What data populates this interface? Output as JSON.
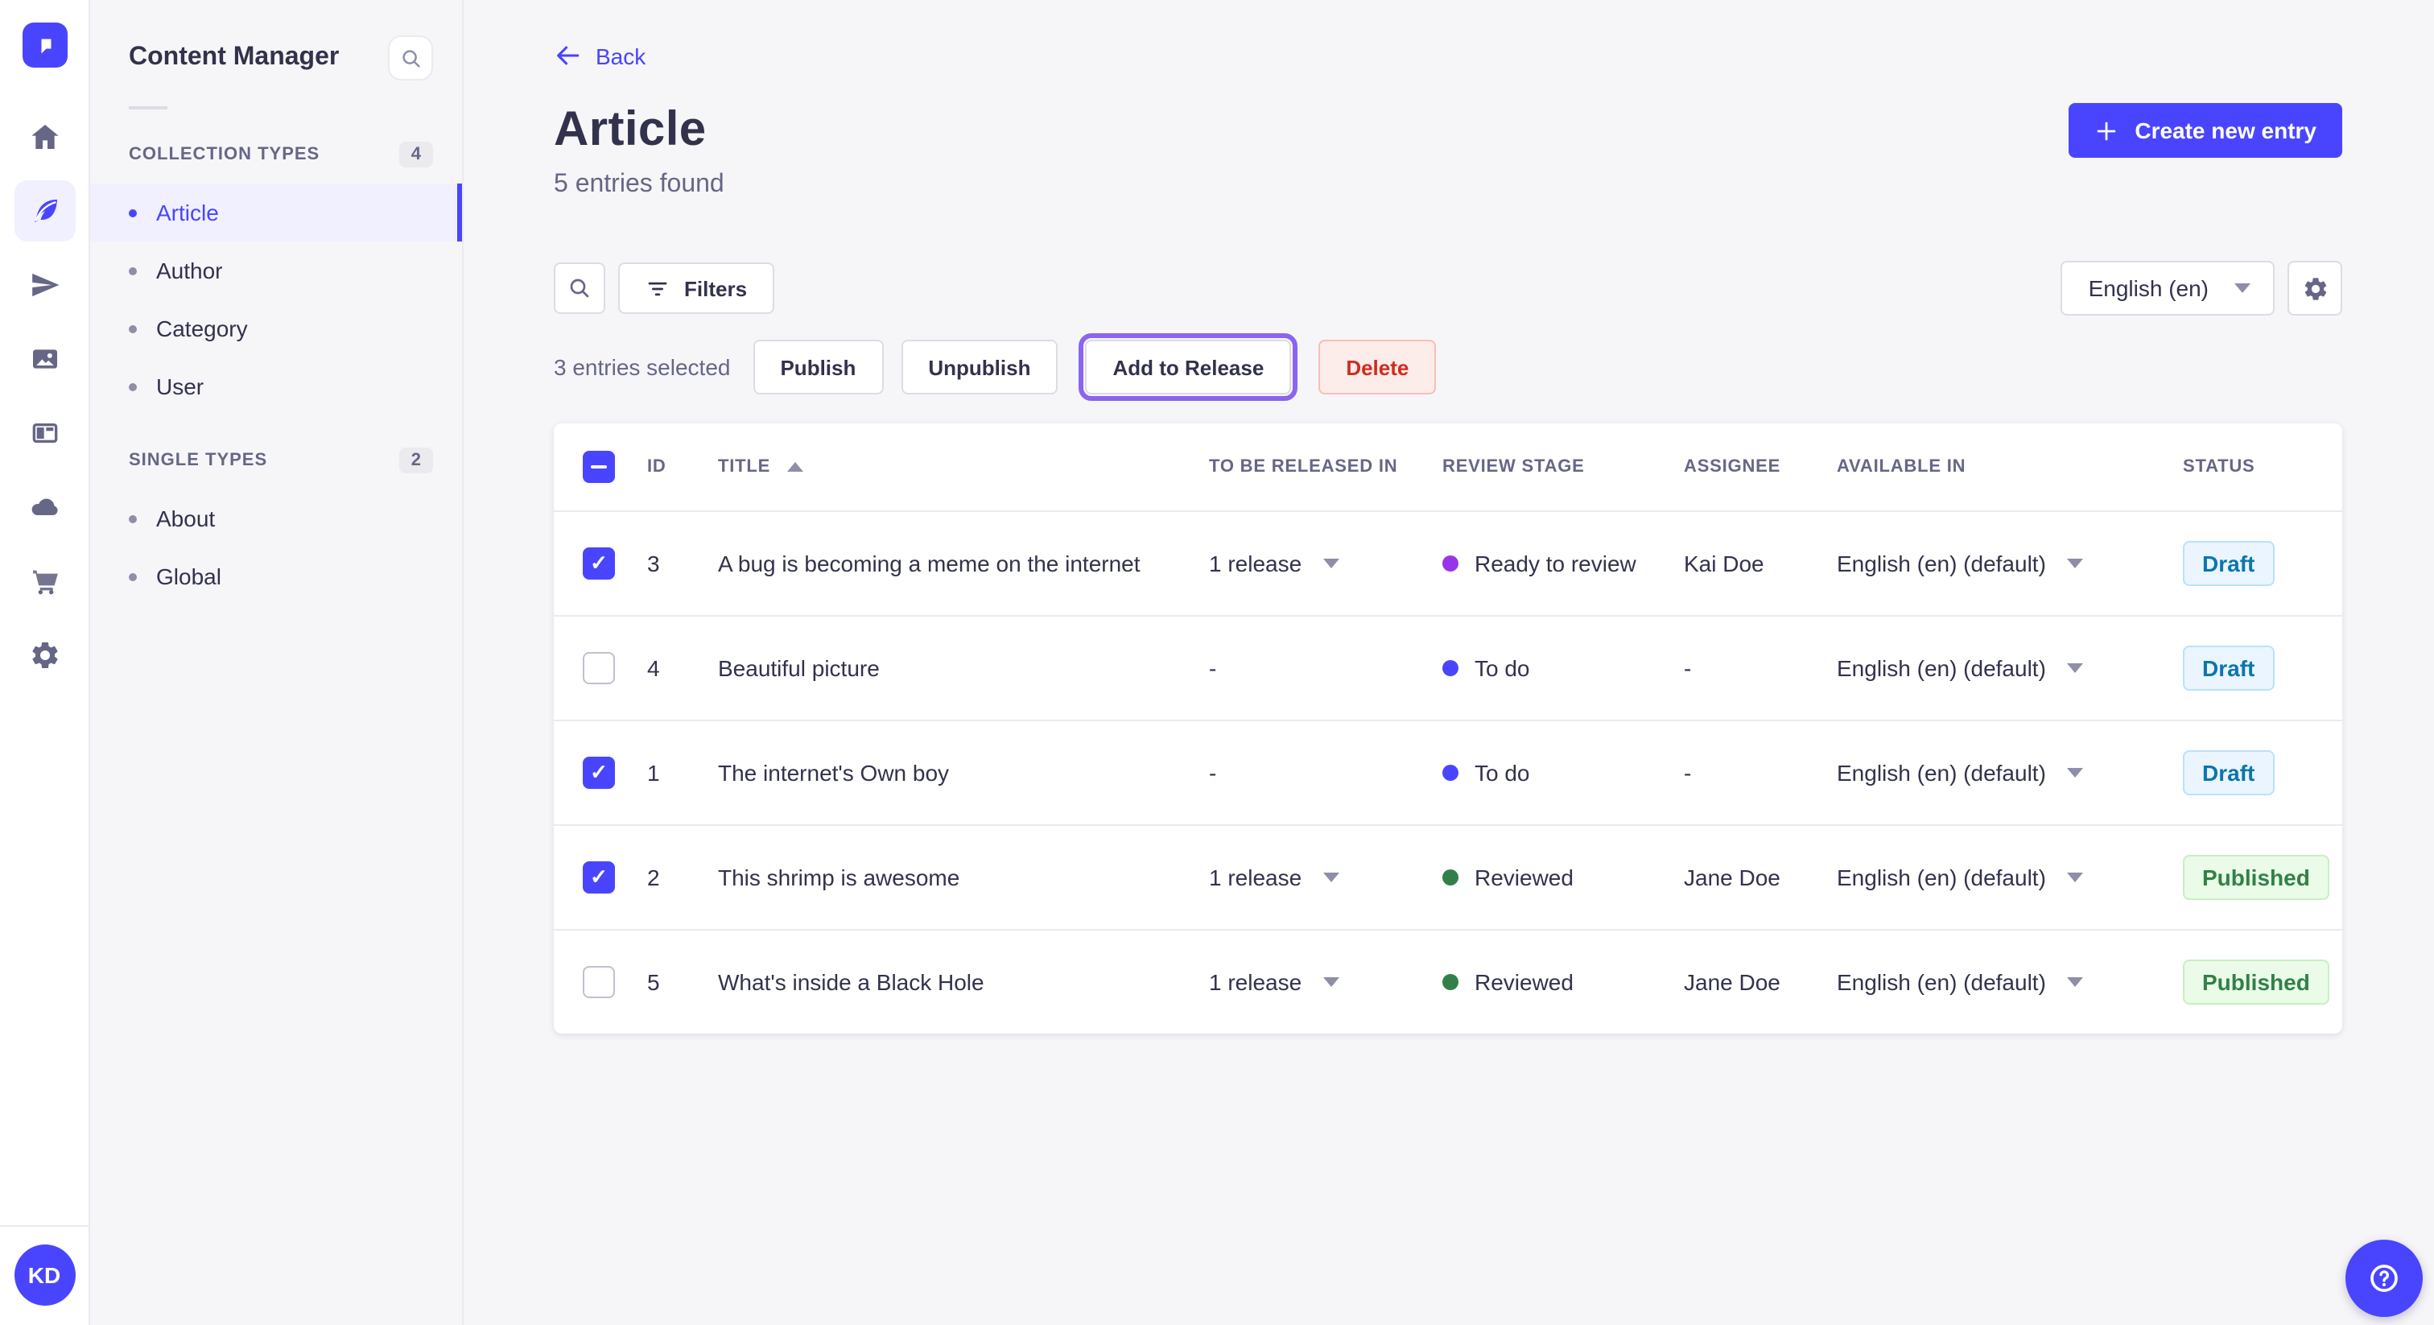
{
  "nav": {
    "logo_icon": "strapi-logo-icon",
    "icons": [
      "home-icon",
      "content-manager-feather-icon",
      "releases-paper-plane-icon",
      "media-library-images-icon",
      "layout-icon",
      "cloud-icon",
      "marketplace-cart-icon",
      "settings-gear-icon"
    ],
    "active_icon_index": 1,
    "avatar_initials": "KD",
    "help_icon": "question-mark-icon"
  },
  "subnav": {
    "title": "Content Manager",
    "search_icon": "search-icon",
    "sections": [
      {
        "label": "COLLECTION TYPES",
        "count": "4",
        "items": [
          {
            "label": "Article",
            "active": true
          },
          {
            "label": "Author",
            "active": false
          },
          {
            "label": "Category",
            "active": false
          },
          {
            "label": "User",
            "active": false
          }
        ]
      },
      {
        "label": "SINGLE TYPES",
        "count": "2",
        "items": [
          {
            "label": "About",
            "active": false
          },
          {
            "label": "Global",
            "active": false
          }
        ]
      }
    ]
  },
  "header": {
    "back_label": "Back",
    "title": "Article",
    "subtitle": "5 entries found",
    "create_button_label": "Create new entry"
  },
  "toolbar": {
    "filters_label": "Filters",
    "locale_selected": "English (en)"
  },
  "selection": {
    "text": "3 entries selected",
    "publish_label": "Publish",
    "unpublish_label": "Unpublish",
    "add_to_release_label": "Add to Release",
    "delete_label": "Delete"
  },
  "table": {
    "columns": [
      "ID",
      "TITLE",
      "TO BE RELEASED IN",
      "REVIEW STAGE",
      "ASSIGNEE",
      "AVAILABLE IN",
      "STATUS"
    ],
    "sorted_column": "TITLE",
    "sort_direction": "asc",
    "header_checkbox_state": "indeterminate",
    "empty_value": "-",
    "rows": [
      {
        "checked": true,
        "id": "3",
        "title": "A bug is becoming a meme on the internet",
        "release": "1 release",
        "stage": "Ready to review",
        "stage_color": "#9736e8",
        "assignee": "Kai Doe",
        "locale": "English (en) (default)",
        "status": "Draft"
      },
      {
        "checked": false,
        "id": "4",
        "title": "Beautiful picture",
        "release": "-",
        "stage": "To do",
        "stage_color": "#4945ff",
        "assignee": "-",
        "locale": "English (en) (default)",
        "status": "Draft"
      },
      {
        "checked": true,
        "id": "1",
        "title": "The internet's Own boy",
        "release": "-",
        "stage": "To do",
        "stage_color": "#4945ff",
        "assignee": "-",
        "locale": "English (en) (default)",
        "status": "Draft"
      },
      {
        "checked": true,
        "id": "2",
        "title": "This shrimp is awesome",
        "release": "1 release",
        "stage": "Reviewed",
        "stage_color": "#328048",
        "assignee": "Jane Doe",
        "locale": "English (en) (default)",
        "status": "Published"
      },
      {
        "checked": false,
        "id": "5",
        "title": "What's inside a Black Hole",
        "release": "1 release",
        "stage": "Reviewed",
        "stage_color": "#328048",
        "assignee": "Jane Doe",
        "locale": "English (en) (default)",
        "status": "Published"
      }
    ]
  },
  "colors": {
    "primary": "#4945ff",
    "primary_light_bg": "#f0f0ff",
    "focus_ring": "#8c64f0",
    "danger_text": "#d02b20",
    "danger_bg": "#fcecea",
    "draft_text": "#0c75af",
    "draft_bg": "#eaf5ff",
    "published_text": "#328048",
    "published_bg": "#eafbe7",
    "stage_todo": "#4945ff",
    "stage_ready_to_review": "#9736e8",
    "stage_reviewed": "#328048"
  }
}
